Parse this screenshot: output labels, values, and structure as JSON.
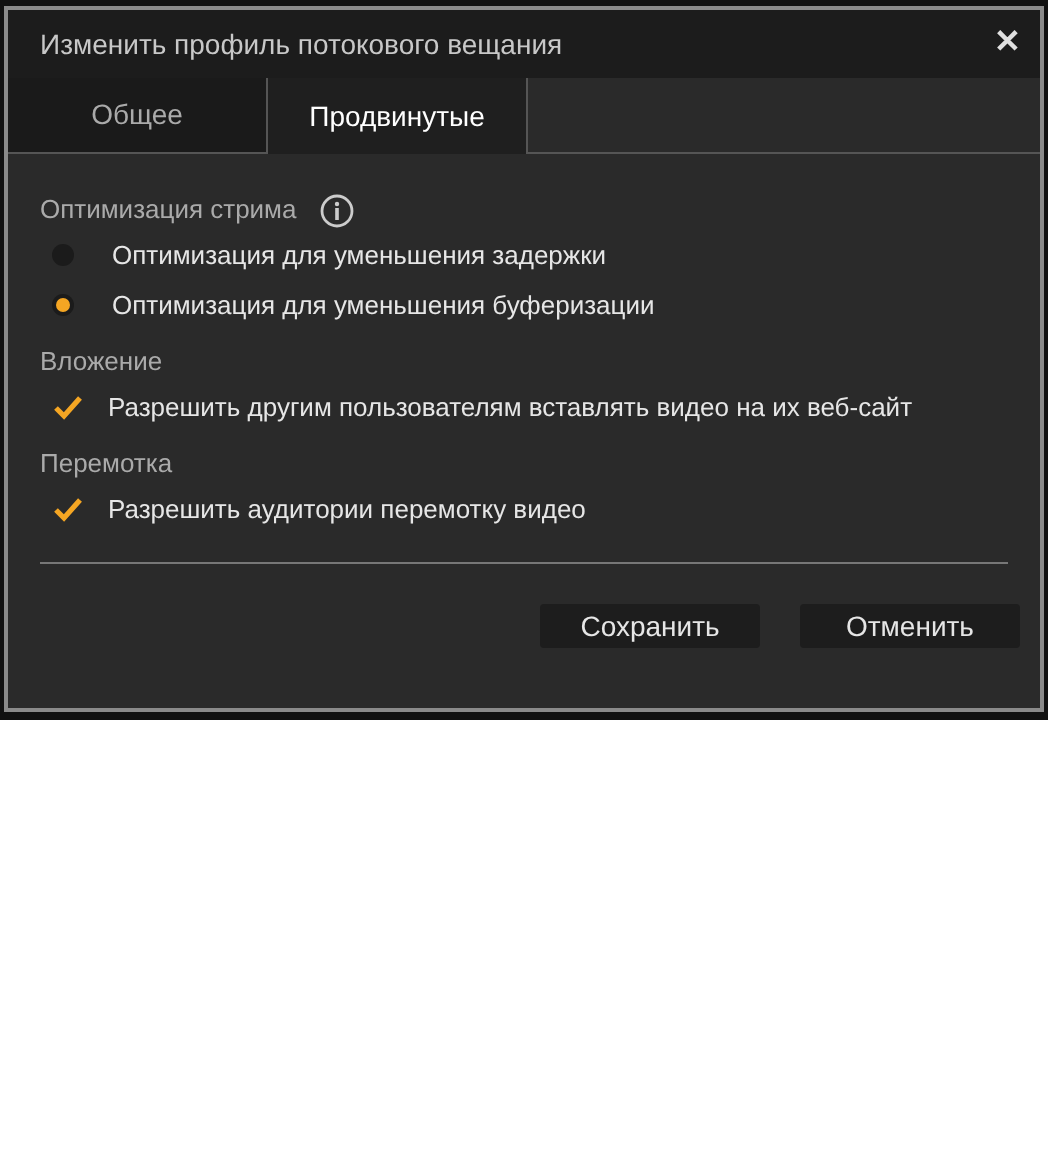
{
  "window": {
    "title": "Изменить профиль потокового вещания",
    "close": "✕"
  },
  "tabs": [
    {
      "label": "Общее",
      "selected": false
    },
    {
      "label": "Продвинутые",
      "selected": true
    }
  ],
  "sections": [
    {
      "title": "Оптимизация стрима",
      "info": true,
      "options": [
        {
          "kind": "radio",
          "label": "Оптимизация для уменьшения задержки",
          "selected": false
        },
        {
          "kind": "radio",
          "label": "Оптимизация для уменьшения буферизации",
          "selected": true
        }
      ]
    },
    {
      "title": "Вложение",
      "info": false,
      "options": [
        {
          "kind": "checkbox",
          "label": "Разрешить другим пользователям вставлять видео на их веб-сайт",
          "checked": true
        }
      ]
    },
    {
      "title": "Перемотка",
      "info": false,
      "options": [
        {
          "kind": "checkbox",
          "label": "Разрешить аудитории перемотку видео",
          "checked": true
        }
      ]
    }
  ],
  "buttons": [
    "Сохранить",
    "Отменить"
  ]
}
